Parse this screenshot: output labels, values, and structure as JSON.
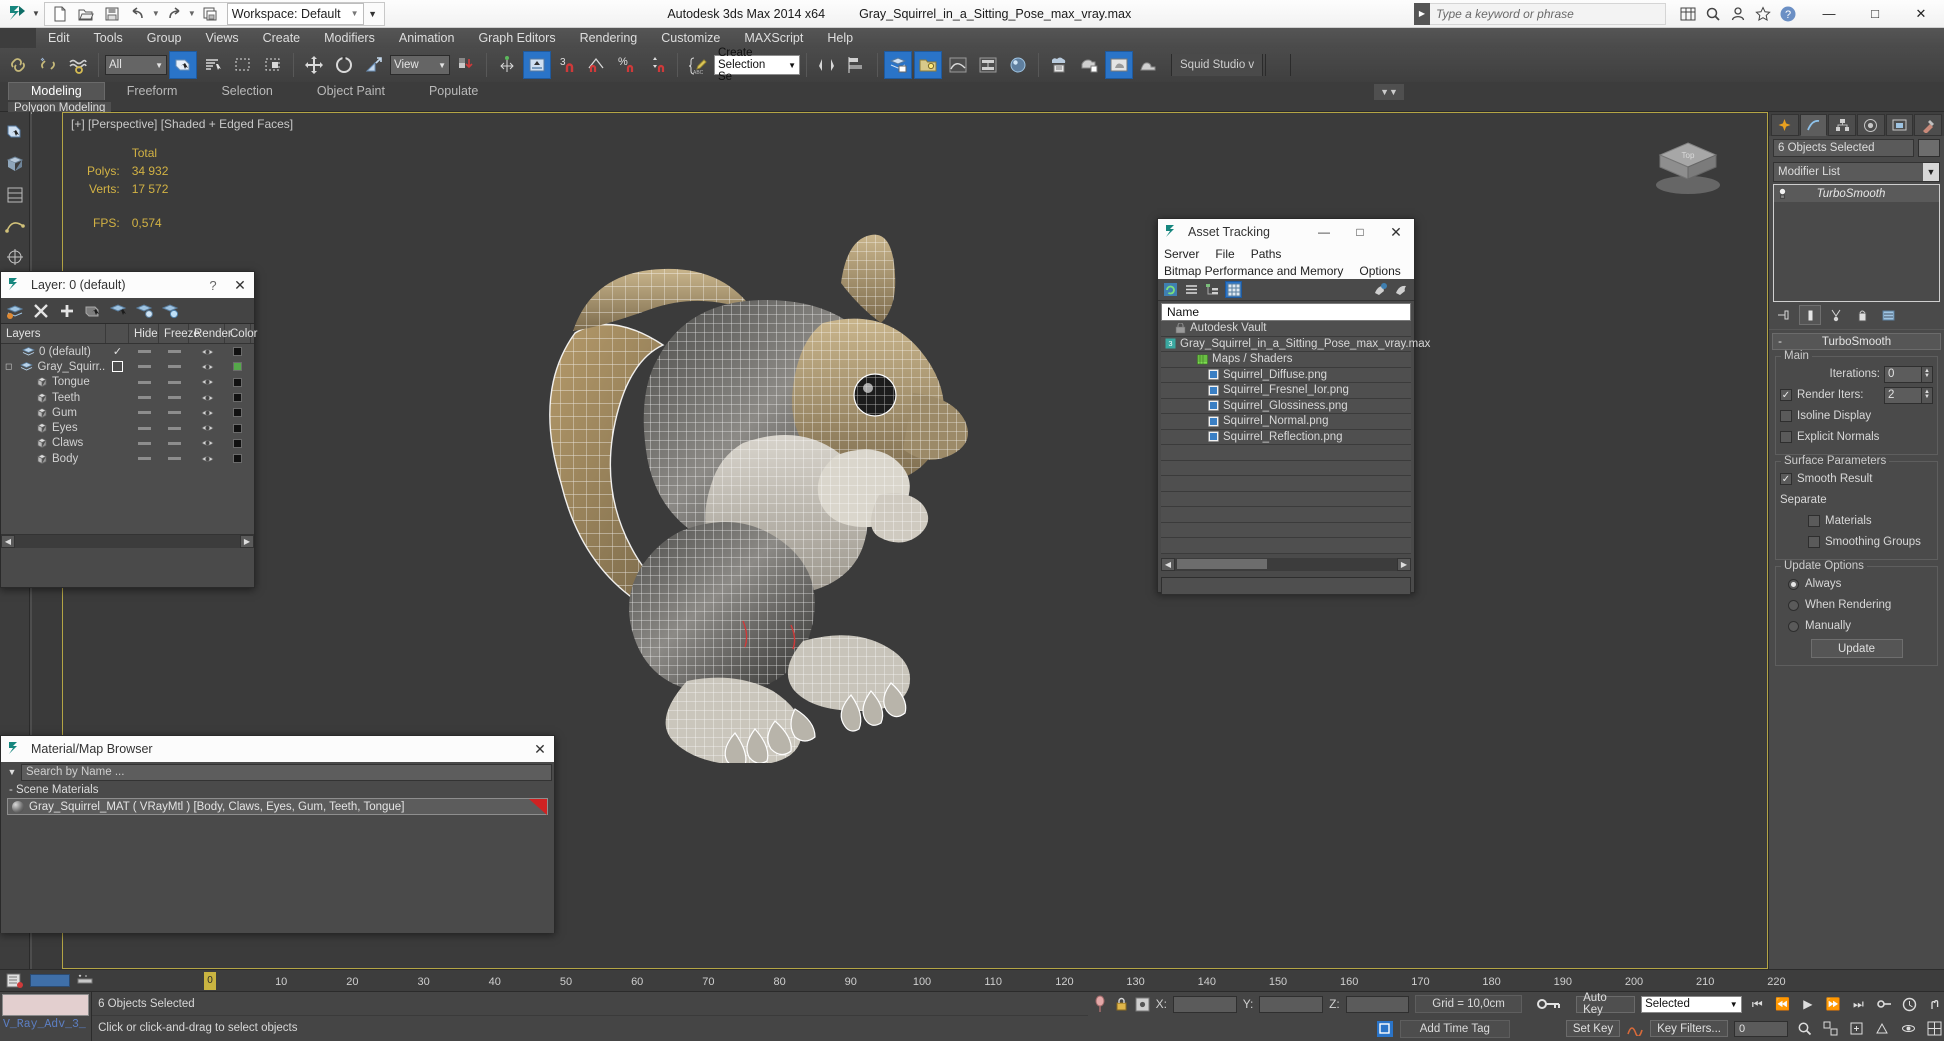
{
  "titlebar": {
    "workspace": "Workspace: Default",
    "app_title": "Autodesk 3ds Max  2014 x64",
    "file_name": "Gray_Squirrel_in_a_Sitting_Pose_max_vray.max",
    "search_placeholder": "Type a keyword or phrase",
    "minimize": "—",
    "maximize": "□",
    "close": "✕"
  },
  "menubar": {
    "items": [
      "Edit",
      "Tools",
      "Group",
      "Views",
      "Create",
      "Modifiers",
      "Animation",
      "Graph Editors",
      "Rendering",
      "Customize",
      "MAXScript",
      "Help"
    ]
  },
  "toolbar": {
    "selection_filter": "All",
    "reference_coord": "View",
    "named_selection_set": "Create Selection Se",
    "renderer_label": "Squid Studio v"
  },
  "ribbon": {
    "tabs": [
      "Modeling",
      "Freeform",
      "Selection",
      "Object Paint",
      "Populate"
    ],
    "active_tab": "Modeling",
    "subtab": "Polygon Modeling"
  },
  "viewport": {
    "label": "[+] [Perspective] [Shaded + Edged Faces]",
    "stats_header": "Total",
    "polys_label": "Polys:",
    "polys_value": "34 932",
    "verts_label": "Verts:",
    "verts_value": "17 572",
    "fps_label": "FPS:",
    "fps_value": "0,574",
    "viewcube_top": "Top"
  },
  "layer_dialog": {
    "title": "Layer: 0 (default)",
    "help": "?",
    "close": "✕",
    "columns": [
      "Layers",
      "Hide",
      "Freeze",
      "Render",
      "Color"
    ],
    "rows": [
      {
        "name": "0 (default)",
        "indent": 0,
        "type": "layer",
        "active": "check",
        "hide": "-",
        "freeze": "-",
        "render": "on",
        "color": "#111111"
      },
      {
        "name": "Gray_Squirr...Sitting",
        "indent": 0,
        "type": "layer",
        "active": "box",
        "hide": "-",
        "freeze": "-",
        "render": "on",
        "color": "#55a84a"
      },
      {
        "name": "Tongue",
        "indent": 1,
        "type": "object",
        "active": "",
        "hide": "-",
        "freeze": "-",
        "render": "on",
        "color": "#111111"
      },
      {
        "name": "Teeth",
        "indent": 1,
        "type": "object",
        "active": "",
        "hide": "-",
        "freeze": "-",
        "render": "on",
        "color": "#111111"
      },
      {
        "name": "Gum",
        "indent": 1,
        "type": "object",
        "active": "",
        "hide": "-",
        "freeze": "-",
        "render": "on",
        "color": "#111111"
      },
      {
        "name": "Eyes",
        "indent": 1,
        "type": "object",
        "active": "",
        "hide": "-",
        "freeze": "-",
        "render": "on",
        "color": "#111111"
      },
      {
        "name": "Claws",
        "indent": 1,
        "type": "object",
        "active": "",
        "hide": "-",
        "freeze": "-",
        "render": "on",
        "color": "#111111"
      },
      {
        "name": "Body",
        "indent": 1,
        "type": "object",
        "active": "",
        "hide": "-",
        "freeze": "-",
        "render": "on",
        "color": "#111111"
      }
    ]
  },
  "material_browser": {
    "title": "Material/Map Browser",
    "close": "✕",
    "search_placeholder": "Search by Name ...",
    "group_label": "- Scene Materials",
    "material": "Gray_Squirrel_MAT  ( VRayMtl )  [Body, Claws, Eyes, Gum, Teeth, Tongue]"
  },
  "asset_tracking": {
    "title": "Asset Tracking",
    "minimize": "—",
    "maximize": "□",
    "close": "✕",
    "menu_row1": [
      "Server",
      "File",
      "Paths"
    ],
    "menu_row2": [
      "Bitmap Performance and Memory",
      "Options"
    ],
    "column_name": "Name",
    "rows": [
      {
        "label": "Autodesk Vault",
        "indent": 0,
        "icon": "vault-icon"
      },
      {
        "label": "Gray_Squirrel_in_a_Sitting_Pose_max_vray.max",
        "indent": 1,
        "icon": "max-file-icon"
      },
      {
        "label": "Maps / Shaders",
        "indent": 2,
        "icon": "maps-icon"
      },
      {
        "label": "Squirrel_Diffuse.png",
        "indent": 3,
        "icon": "bitmap-icon"
      },
      {
        "label": "Squirrel_Fresnel_Ior.png",
        "indent": 3,
        "icon": "bitmap-icon"
      },
      {
        "label": "Squirrel_Glossiness.png",
        "indent": 3,
        "icon": "bitmap-icon"
      },
      {
        "label": "Squirrel_Normal.png",
        "indent": 3,
        "icon": "bitmap-icon"
      },
      {
        "label": "Squirrel_Reflection.png",
        "indent": 3,
        "icon": "bitmap-icon"
      }
    ]
  },
  "command_panel": {
    "object_name": "6 Objects Selected",
    "modifier_list": "Modifier List",
    "stack": [
      "TurboSmooth"
    ],
    "rollup_title": "TurboSmooth",
    "rollup_collapse": "-",
    "main_group": "Main",
    "iterations_label": "Iterations:",
    "iterations_value": "0",
    "render_iters_label": "Render Iters:",
    "render_iters_value": "2",
    "render_iters_checked": true,
    "isoline_label": "Isoline Display",
    "isoline_checked": false,
    "explicit_normals_label": "Explicit Normals",
    "explicit_normals_checked": false,
    "surface_group": "Surface Parameters",
    "smooth_result_label": "Smooth Result",
    "smooth_result_checked": true,
    "separate_label": "Separate",
    "materials_label": "Materials",
    "materials_checked": false,
    "smoothing_groups_label": "Smoothing Groups",
    "smoothing_groups_checked": false,
    "update_group": "Update Options",
    "update_options": [
      "Always",
      "When Rendering",
      "Manually"
    ],
    "update_selected": "Always",
    "update_button": "Update"
  },
  "trackbar": {
    "ticks": [
      "0",
      "10",
      "20",
      "30",
      "40",
      "50",
      "60",
      "70",
      "80",
      "90",
      "100",
      "110",
      "120",
      "130",
      "140",
      "150",
      "160",
      "170",
      "180",
      "190",
      "200",
      "210",
      "220"
    ],
    "current_frame": "0"
  },
  "statusbar": {
    "renderer_name": "V_Ray_Adv_3_",
    "selection_status": "6 Objects Selected",
    "prompt": "Click or click-and-drag to select objects",
    "x_label": "X:",
    "y_label": "Y:",
    "z_label": "Z:",
    "x_value": "",
    "y_value": "",
    "z_value": "",
    "grid": "Grid = 10,0cm",
    "add_time_tag": "Add Time Tag",
    "auto_key": "Auto Key",
    "set_key": "Set Key",
    "key_filter_select": "Selected",
    "key_filters": "Key Filters...",
    "frame_field": "0"
  },
  "colors": {
    "accent_blue": "#2a74c8",
    "viewport_border": "#b4a545",
    "stats_yellow": "#d2b244",
    "layer_green": "#55a84a",
    "material_red": "#cf2222"
  }
}
